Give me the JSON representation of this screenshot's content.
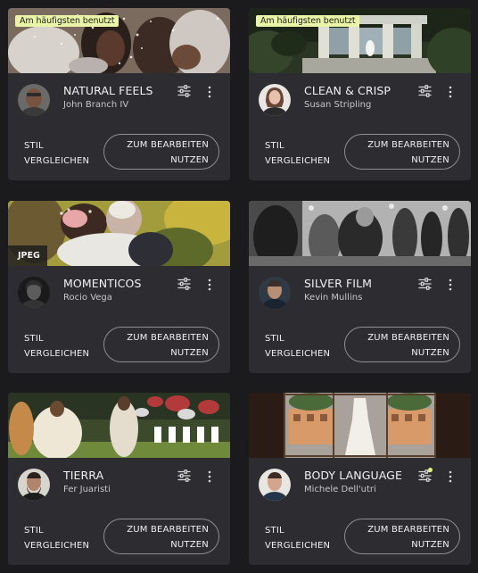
{
  "cards": [
    {
      "badge": "Am häufigsten benutzt",
      "title": "NATURAL FEELS",
      "author": "John Branch IV",
      "compare_label": "STIL\nVERGLEICHEN",
      "use_label": "ZUM BEARBEITEN\nNUTZEN"
    },
    {
      "badge": "Am häufigsten benutzt",
      "title": "CLEAN & CRISP",
      "author": "Susan Stripling",
      "compare_label": "STIL\nVERGLEICHEN",
      "use_label": "ZUM BEARBEITEN\nNUTZEN"
    },
    {
      "format": "JPEG",
      "title": "MOMENTICOS",
      "author": "Rocio Vega",
      "compare_label": "STIL\nVERGLEICHEN",
      "use_label": "ZUM BEARBEITEN\nNUTZEN"
    },
    {
      "title": "SILVER FILM",
      "author": "Kevin Mullins",
      "compare_label": "STIL\nVERGLEICHEN",
      "use_label": "ZUM BEARBEITEN\nNUTZEN"
    },
    {
      "title": "TIERRA",
      "author": "Fer Juaristi",
      "compare_label": "STIL\nVERGLEICHEN",
      "use_label": "ZUM BEARBEITEN\nNUTZEN"
    },
    {
      "title": "BODY LANGUAGE",
      "author": "Michele Dell'utri",
      "compare_label": "STIL\nVERGLEICHEN",
      "use_label": "ZUM BEARBEITEN\nNUTZEN",
      "adjust_active": true
    }
  ],
  "icons": {
    "adjust": "sliders-icon",
    "more": "more-vertical-icon"
  },
  "colors": {
    "card_bg": "#2d2c31",
    "page_bg": "#1b1b1d",
    "badge_bg": "#eaf5a8",
    "active_dot": "#e2f08a",
    "button_border": "#8e8d92"
  }
}
